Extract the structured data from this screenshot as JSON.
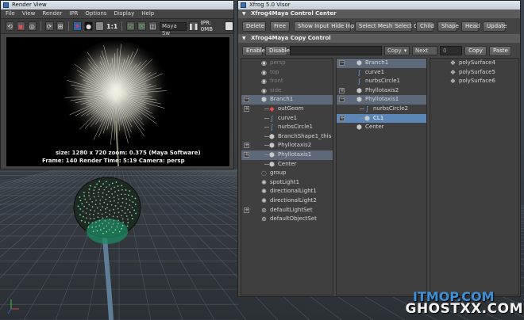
{
  "render_view": {
    "title": "Render View",
    "menu": [
      "File",
      "View",
      "Render",
      "IPR",
      "Options",
      "Display",
      "Help"
    ],
    "toolbar": {
      "ratio_label": "1:1",
      "renderer_field": "Maya Sw",
      "ipr_label": "IPR: 0MB"
    },
    "info_line1": "size: 1280 x 720  zoom: 0.375        (Maya Software)",
    "info_line2": "Frame: 140       Render Time: 5:19       Camera: persp"
  },
  "visor": {
    "title": "Xfrog 5.0 Visor",
    "control_center": {
      "header": "Xfrog4Maya Control Center",
      "buttons": [
        "Delete",
        "Free",
        "Show Input",
        "Hide Input",
        "Select Mesh",
        "Select Obj",
        "Child",
        "Shape",
        "Head",
        "Update"
      ]
    },
    "copy_control": {
      "header": "Xfrog4Maya Copy Control",
      "enable_label": "Enable",
      "disable_label": "Disable",
      "copy_select": "Copy",
      "next_label": "Next",
      "number_value": "0",
      "copy_button": "Copy",
      "paste_button": "Paste"
    },
    "column1": [
      {
        "label": "persp",
        "icon": "camera",
        "dim": true,
        "indent": 0
      },
      {
        "label": "top",
        "icon": "camera",
        "dim": true,
        "indent": 0
      },
      {
        "label": "front",
        "icon": "camera",
        "dim": true,
        "indent": 0
      },
      {
        "label": "side",
        "icon": "camera",
        "dim": true,
        "indent": 0
      },
      {
        "label": "Branch1",
        "icon": "node",
        "expander": "−",
        "selected": true,
        "indent": 0
      },
      {
        "label": "outGeom",
        "icon": "geom",
        "expander": "+",
        "indent": 1
      },
      {
        "label": "curve1",
        "icon": "curve",
        "indent": 1
      },
      {
        "label": "nurbsCircle1",
        "icon": "curve",
        "indent": 1
      },
      {
        "label": "BranchShape1_this",
        "icon": "node",
        "indent": 1
      },
      {
        "label": "Phyllotaxis2",
        "icon": "node",
        "expander": "+",
        "indent": 1
      },
      {
        "label": "Phyllotaxis1",
        "icon": "node",
        "expander": "+",
        "selected": true,
        "indent": 1
      },
      {
        "label": "Center",
        "icon": "node",
        "indent": 1
      },
      {
        "label": "group",
        "icon": "group",
        "indent": 0
      },
      {
        "label": "spotLight1",
        "icon": "light",
        "indent": 0
      },
      {
        "label": "directionalLight1",
        "icon": "light",
        "indent": 0
      },
      {
        "label": "directionalLight2",
        "icon": "light",
        "indent": 0
      },
      {
        "label": "defaultLightSet",
        "icon": "set",
        "expander": "+",
        "indent": 0
      },
      {
        "label": "defaultObjectSet",
        "icon": "set",
        "indent": 0
      }
    ],
    "column2": [
      {
        "label": "Branch1",
        "icon": "node",
        "expander": "−",
        "selected": true,
        "indent": 0
      },
      {
        "label": "curve1",
        "icon": "curve",
        "indent": 0
      },
      {
        "label": "nurbsCircle1",
        "icon": "curve",
        "indent": 0
      },
      {
        "label": "Phyllotaxis2",
        "icon": "node",
        "expander": "+",
        "indent": 0
      },
      {
        "label": "Phyllotaxis1",
        "icon": "node",
        "expander": "−",
        "selected": true,
        "indent": 0
      },
      {
        "label": "nurbsCircle2",
        "icon": "curve",
        "indent": 1
      },
      {
        "label": "CL1",
        "icon": "node",
        "expander": "+",
        "highlight": true,
        "indent": 1
      },
      {
        "label": "Center",
        "icon": "node",
        "indent": 0
      }
    ],
    "column3": [
      {
        "label": "polySurface4",
        "icon": "mesh",
        "indent": 0
      },
      {
        "label": "polySurface5",
        "icon": "mesh",
        "indent": 0
      },
      {
        "label": "polySurface6",
        "icon": "mesh",
        "indent": 0
      }
    ]
  },
  "watermark": {
    "line1": "ITMOP.COM",
    "line2": "GHOSTXX.COM"
  },
  "colors": {
    "selection": "#5d6878",
    "highlight": "#5b86b6",
    "title_bar": "#c4ccd6"
  }
}
